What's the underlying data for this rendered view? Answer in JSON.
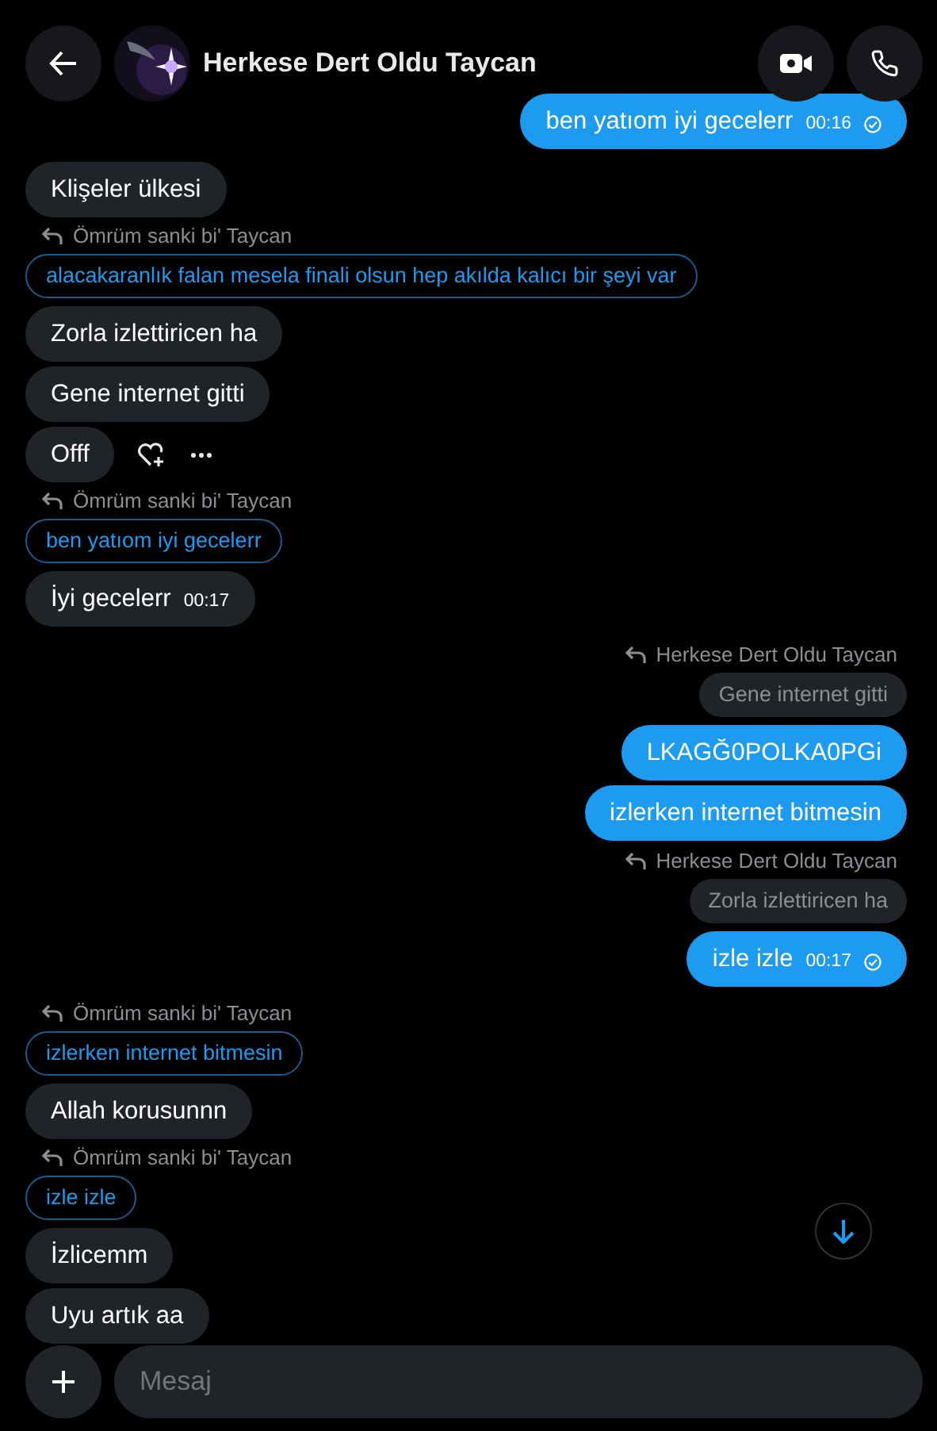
{
  "header": {
    "title": "Herkese Dert Oldu Taycan"
  },
  "messages": [
    {
      "outgoing": true,
      "text": "ben yatıom iyi gecelerr",
      "time": "00:16",
      "read": true
    },
    {
      "outgoing": false,
      "text": "Klişeler ülkesi"
    },
    {
      "outgoing": false,
      "text": "Zorla izlettiricen ha",
      "reply_to": {
        "author": "Ömrüm sanki bi' Taycan",
        "text": "alacakaranlık falan mesela finali olsun hep akılda kalıcı bir şeyi var"
      }
    },
    {
      "outgoing": false,
      "text": "Gene internet gitti"
    },
    {
      "outgoing": false,
      "text": "Offf",
      "hovered": true
    },
    {
      "outgoing": false,
      "text": "İyi gecelerr",
      "time": "00:17",
      "reply_to": {
        "author": "Ömrüm sanki bi' Taycan",
        "text": "ben yatıom iyi gecelerr"
      }
    },
    {
      "outgoing": true,
      "text": "LKAGĞ0POLKA0PGi",
      "reply_to": {
        "author": "Herkese Dert Oldu Taycan",
        "text": "Gene internet gitti"
      }
    },
    {
      "outgoing": true,
      "text": "izlerken internet bitmesin"
    },
    {
      "outgoing": true,
      "text": "izle izle",
      "time": "00:17",
      "read": true,
      "reply_to": {
        "author": "Herkese Dert Oldu Taycan",
        "text": "Zorla izlettiricen ha"
      }
    },
    {
      "outgoing": false,
      "text": "Allah korusunnn",
      "reply_to": {
        "author": "Ömrüm sanki bi' Taycan",
        "text": "izlerken internet bitmesin"
      }
    },
    {
      "outgoing": false,
      "text": "İzlicemm",
      "reply_to": {
        "author": "Ömrüm sanki bi' Taycan",
        "text": "izle izle"
      }
    },
    {
      "outgoing": false,
      "text": "Uyu artık aa"
    }
  ],
  "composer": {
    "placeholder": "Mesaj"
  }
}
